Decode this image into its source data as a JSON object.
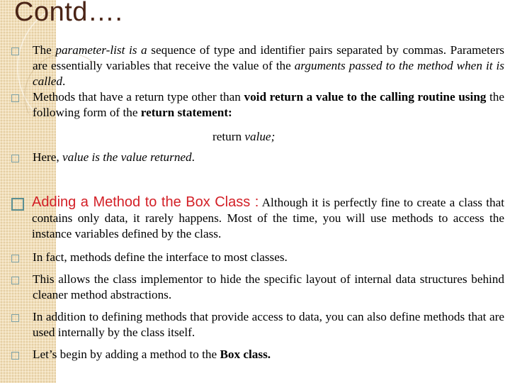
{
  "slide": {
    "title": "Contd….",
    "bullets": [
      {
        "parts": [
          {
            "t": "The "
          },
          {
            "t": "parameter-list is a",
            "style": "i"
          },
          {
            "t": " sequence of type and identifier pairs separated by commas. Parameters are essentially variables that receive the value of the "
          },
          {
            "t": "arguments passed to the method when it is called",
            "style": "i"
          },
          {
            "t": "."
          }
        ]
      },
      {
        "parts": [
          {
            "t": "Methods that have a return type other than "
          },
          {
            "t": "void return a value to the calling routine using",
            "style": "b"
          },
          {
            "t": " the following form of the "
          },
          {
            "t": "return statement:",
            "style": "b"
          }
        ]
      },
      {
        "parts": [
          {
            "t": "Here, "
          },
          {
            "t": "value is the value returned",
            "style": "i"
          },
          {
            "t": "."
          }
        ]
      },
      {
        "heading": "Adding a Method to the Box Class :",
        "parts": [
          {
            "t": " Although it is perfectly fine to create a class that contains only data, it rarely happens. Most of the time, you will use methods to access the instance variables defined by the class."
          }
        ]
      },
      {
        "parts": [
          {
            "t": "In fact, methods define the interface to most classes."
          }
        ]
      },
      {
        "parts": [
          {
            "t": "This allows the class implementor to hide the specific layout of internal data structures behind cleaner method abstractions."
          }
        ]
      },
      {
        "parts": [
          {
            "t": "In addition to defining methods that provide access to data, you can also define methods that are used internally by the class itself."
          }
        ]
      },
      {
        "parts": [
          {
            "t": "Let’s begin by adding a method to the "
          },
          {
            "t": "Box class.",
            "style": "b"
          }
        ]
      }
    ],
    "return_stmt": {
      "keyword": "return ",
      "value": "value;"
    }
  },
  "colors": {
    "title": "#4a2416",
    "heading": "#d31f26",
    "bullet": "#7fa3a8",
    "band": "#f1dfba"
  }
}
